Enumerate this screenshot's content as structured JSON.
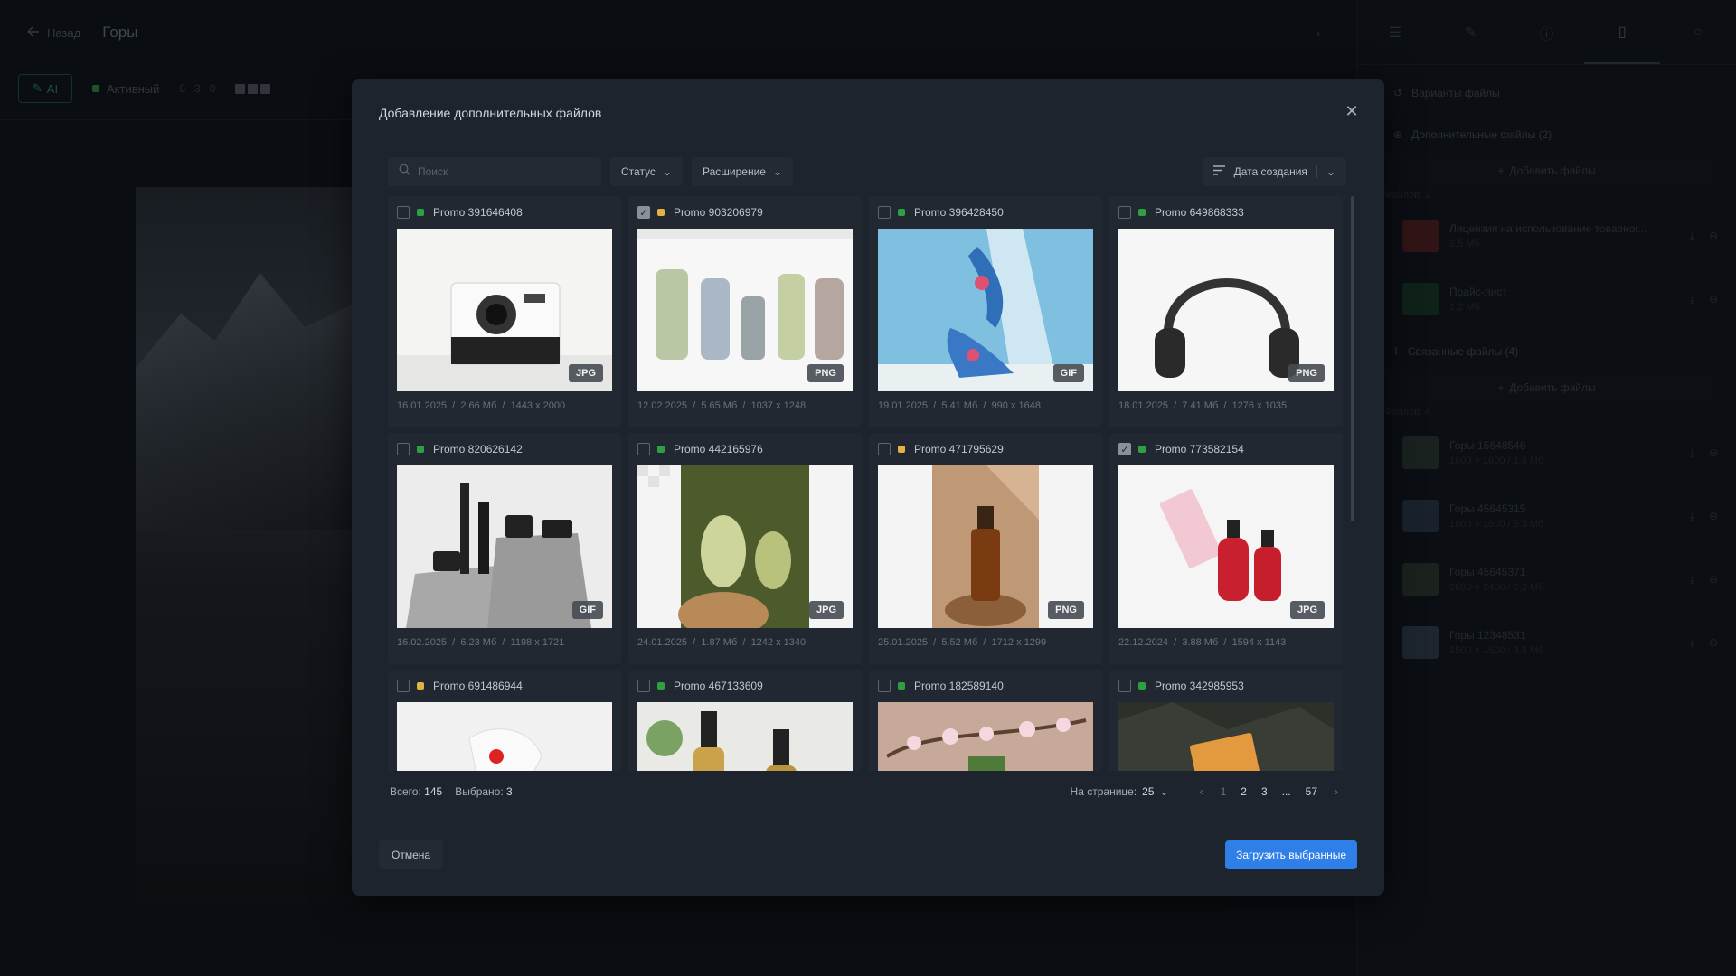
{
  "app": {
    "back_label": "Назад",
    "page_title": "Горы",
    "ai_label": "AI",
    "status_label": "Активный",
    "mini_counts": [
      "0",
      "3",
      "0"
    ]
  },
  "right_panel": {
    "variants_label": "Варианты файлы",
    "extra_files_label": "Дополнительные файлы (2)",
    "add_files_label": "Добавить файлы",
    "extra_count_label": "Файлов: 2",
    "extra_files": [
      {
        "name": "Лицензия на использование товарног...",
        "meta": "2.5 Мб",
        "icon": "pdf-icon"
      },
      {
        "name": "Прайс-лист",
        "meta": "1.2 Мб",
        "icon": "excel-icon"
      }
    ],
    "linked_files_label": "Связанные файлы (4)",
    "linked_count_label": "Файлов: 4",
    "linked_files": [
      {
        "name": "Горы 15648546",
        "meta": "1600 × 1600 / 1.8 Мб"
      },
      {
        "name": "Горы 45645315",
        "meta": "1600 × 1600 / 5.3 Мб"
      },
      {
        "name": "Горы 45645371",
        "meta": "2600 × 2400 / 2.2 Мб"
      },
      {
        "name": "Горы 12348531",
        "meta": "1500 × 1500 / 3.8 Мб"
      }
    ]
  },
  "modal": {
    "title": "Добавление дополнительных файлов",
    "search_placeholder": "Поиск",
    "status_filter": "Статус",
    "ext_filter": "Расширение",
    "sort_label": "Дата создания",
    "cards": [
      {
        "name": "Promo 391646408",
        "status": "green",
        "checked": false,
        "ext": "JPG",
        "date": "16.01.2025",
        "size": "2.66 Мб",
        "dims": "1443 x 2000",
        "art": "camera"
      },
      {
        "name": "Promo 903206979",
        "status": "yellow",
        "checked": true,
        "ext": "PNG",
        "date": "12.02.2025",
        "size": "5.65 Мб",
        "dims": "1037 x 1248",
        "art": "tubes"
      },
      {
        "name": "Promo 396428450",
        "status": "green",
        "checked": false,
        "ext": "GIF",
        "date": "19.01.2025",
        "size": "5.41 Мб",
        "dims": "990 x 1648",
        "art": "shoes"
      },
      {
        "name": "Promo 649868333",
        "status": "green",
        "checked": false,
        "ext": "PNG",
        "date": "18.01.2025",
        "size": "7.41 Мб",
        "dims": "1276 x 1035",
        "art": "headphones"
      },
      {
        "name": "Promo 820626142",
        "status": "green",
        "checked": false,
        "ext": "GIF",
        "date": "16.02.2025",
        "size": "6.23 Мб",
        "dims": "1198 x 1721",
        "art": "cosmetics"
      },
      {
        "name": "Promo 442165976",
        "status": "green",
        "checked": false,
        "ext": "JPG",
        "date": "24.01.2025",
        "size": "1.87 Мб",
        "dims": "1242 x 1340",
        "art": "sponges"
      },
      {
        "name": "Promo 471795629",
        "status": "yellow",
        "checked": false,
        "ext": "PNG",
        "date": "25.01.2025",
        "size": "5.52 Мб",
        "dims": "1712 x 1299",
        "art": "bottle"
      },
      {
        "name": "Promo 773582154",
        "status": "green",
        "checked": true,
        "ext": "JPG",
        "date": "22.12.2024",
        "size": "3.88 Мб",
        "dims": "1594 x 1143",
        "art": "serum"
      },
      {
        "name": "Promo 691486944",
        "status": "yellow",
        "checked": false,
        "ext": "",
        "date": "",
        "size": "",
        "dims": "",
        "art": "pouch"
      },
      {
        "name": "Promo 467133609",
        "status": "green",
        "checked": false,
        "ext": "",
        "date": "",
        "size": "",
        "dims": "",
        "art": "droppers"
      },
      {
        "name": "Promo 182589140",
        "status": "green",
        "checked": false,
        "ext": "",
        "date": "",
        "size": "",
        "dims": "",
        "art": "flowers"
      },
      {
        "name": "Promo 342985953",
        "status": "green",
        "checked": false,
        "ext": "",
        "date": "",
        "size": "",
        "dims": "",
        "art": "card"
      }
    ],
    "total_label": "Всего:",
    "total_value": "145",
    "selected_label": "Выбрано:",
    "selected_value": "3",
    "per_page_label": "На странице:",
    "per_page_value": "25",
    "pages": [
      "1",
      "2",
      "3",
      "...",
      "57"
    ],
    "cancel_label": "Отмена",
    "upload_label": "Загрузить выбранные"
  },
  "colors": {
    "status_green": "#2ea043",
    "status_yellow": "#e3b341",
    "accent": "#2f7fe8"
  }
}
